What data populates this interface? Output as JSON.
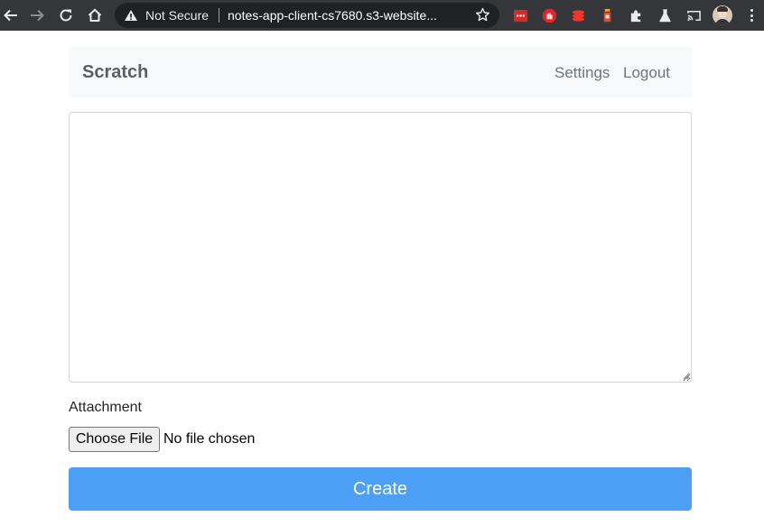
{
  "browser": {
    "security_label": "Not Secure",
    "url": "notes-app-client-cs7680.s3-website..."
  },
  "navbar": {
    "brand": "Scratch",
    "links": [
      "Settings",
      "Logout"
    ]
  },
  "form": {
    "note_content": "",
    "attachment_label": "Attachment",
    "file_button_label": "Choose File",
    "file_status": "No file chosen",
    "submit_label": "Create"
  },
  "colors": {
    "primary_button": "#4d9ff5",
    "navbar_bg": "#f8f9fa",
    "chrome_bg": "#35363a"
  }
}
